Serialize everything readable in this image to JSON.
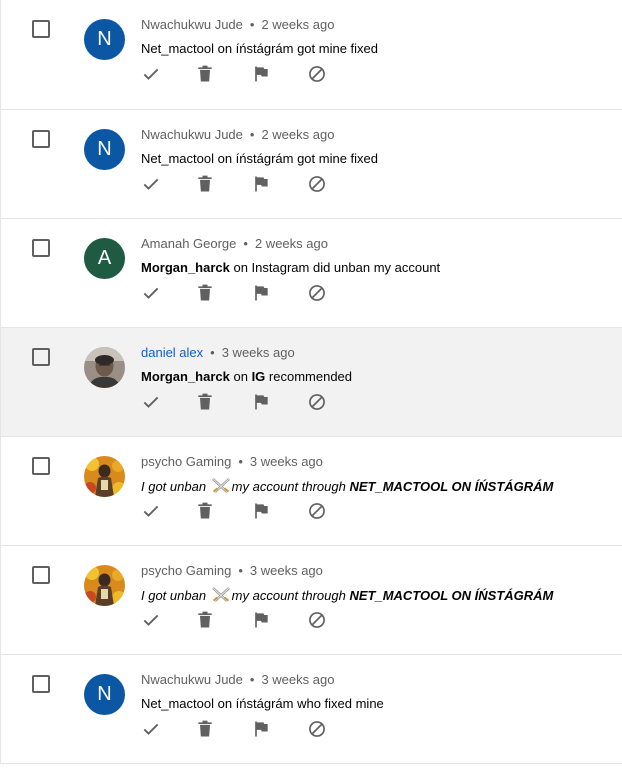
{
  "comments": [
    {
      "author": "Nwachukwu Jude",
      "time": "2 weeks ago",
      "avatar_letter": "N",
      "avatar_color": "#0b57a4",
      "parts": [
        "Net_mactool on íństágrám got mine fixed"
      ]
    },
    {
      "author": "Nwachukwu Jude",
      "time": "2 weeks ago",
      "avatar_letter": "N",
      "avatar_color": "#0b57a4",
      "parts": [
        "Net_mactool on íństágrám got mine fixed"
      ]
    },
    {
      "author": "Amanah George",
      "time": "2 weeks ago",
      "avatar_letter": "A",
      "avatar_color": "#1f5a43",
      "parts": [
        "Morgan_harck",
        " on Instagram did unban my account"
      ]
    },
    {
      "author": "daniel alex",
      "time": "3 weeks ago",
      "avatar_icon": "user-photo",
      "parts": [
        "Morgan_harck",
        " on ",
        "IG",
        " recommended"
      ]
    },
    {
      "author": "psycho Gaming",
      "time": "3 weeks ago",
      "avatar_icon": "game-character-avatar",
      "parts": [
        "I got unban ",
        "my account through ",
        "NET_MACTOOL ON ÍŃSTÁGRÁM"
      ],
      "emoji_icon": "crossed-swords-icon"
    },
    {
      "author": "psycho Gaming",
      "time": "3 weeks ago",
      "avatar_icon": "game-character-avatar",
      "parts": [
        "I got unban ",
        "my account through ",
        "NET_MACTOOL ON ÍŃSTÁGRÁM"
      ],
      "emoji_icon": "crossed-swords-icon"
    },
    {
      "author": "Nwachukwu Jude",
      "time": "3 weeks ago",
      "avatar_letter": "N",
      "avatar_color": "#0b57a4",
      "parts": [
        "Net_mactool on íństágrám who fixed mine"
      ]
    }
  ],
  "separator": "•",
  "colors": {
    "meta_text": "#606060",
    "link_author": "#065fd4",
    "highlight_row": "#f2f2f2",
    "icon_gray": "#606060"
  },
  "actions": [
    {
      "name": "approve",
      "icon": "check-icon"
    },
    {
      "name": "remove",
      "icon": "trash-icon"
    },
    {
      "name": "report",
      "icon": "flag-icon"
    },
    {
      "name": "hide-user",
      "icon": "block-icon"
    }
  ]
}
